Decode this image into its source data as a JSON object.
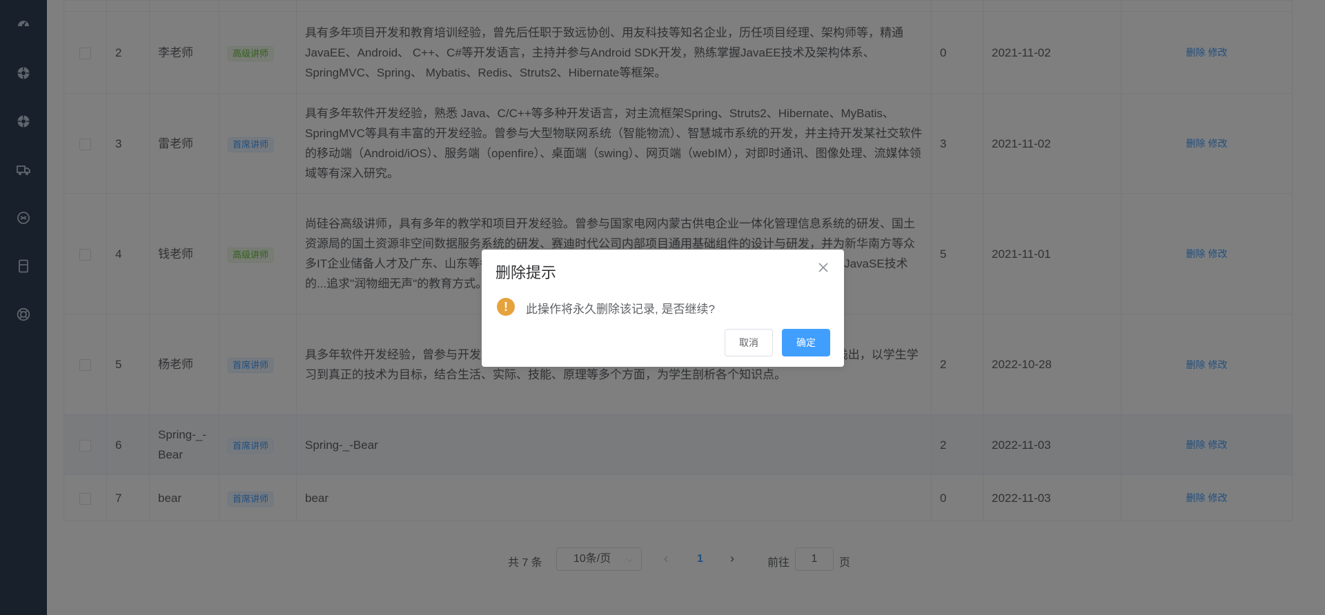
{
  "sidebar": {
    "icons": [
      "dashboard-icon",
      "circle-icon",
      "circle-icon",
      "truck-icon",
      "headset-icon",
      "phone-icon",
      "lifebuoy-icon"
    ]
  },
  "table": {
    "rows": [
      {
        "id": "2",
        "name": "李老师",
        "level": "高级讲师",
        "level_type": "senior",
        "intro": "具有多年项目开发和教育培训经验，曾先后任职于致远协创、用友科技等知名企业，历任项目经理、架构师等，精通JavaEE、Android、 C++、C#等开发语言，主持并参与Android SDK开发，熟练掌握JavaEE技术及架构体系、SpringMVC、Spring、 Mybatis、Redis、Struts2、Hibernate等框架。",
        "sort": "0",
        "date": "2021-11-02",
        "delete": "删除",
        "edit": "修改"
      },
      {
        "id": "3",
        "name": "雷老师",
        "level": "首席讲师",
        "level_type": "chief",
        "intro": "具有多年软件开发经验，熟悉 Java、C/C++等多种开发语言，对主流框架Spring、Struts2、Hibernate、MyBatis、SpringMVC等具有丰富的开发经验。曾参与大型物联网系统（智能物流）、智慧城市系统的开发，并主持开发某社交软件的移动端（Android/iOS）、服务端（openfire）、桌面端（swing）、网页端（webIM），对即时通讯、图像处理、流媒体领域等有深入研究。",
        "sort": "3",
        "date": "2021-11-02",
        "delete": "删除",
        "edit": "修改"
      },
      {
        "id": "4",
        "name": "钱老师",
        "level": "高级讲师",
        "level_type": "senior",
        "intro": "尚硅谷高级讲师，具有多年的教学和项目开发经验。曾参与国家电网内蒙古供电企业一体化管理信息系统的研发、国土资源局的国土资源非空间数据服务系统的研发、赛迪时代公司内部项目通用基础组件的设计与研发，并为新华南方等众多IT企业储备人才及广东、山东等各所高校未做整合出来的项目...MyBatis、JBPM等众多框架，现专注于JavaSE技术的...追求\"润物细无声\"的教育方式。",
        "sort": "5",
        "date": "2021-11-01",
        "delete": "删除",
        "edit": "修改"
      },
      {
        "id": "5",
        "name": "杨老师",
        "level": "首席讲师",
        "level_type": "chief",
        "intro": "具多年软件开发经验，曾参与开发...理有深刻理解，精通jQuery等JavaScript框架...滴，层次明确，深入浅出，以学生学习到真正的技术为目标，结合生活、实际、技能、原理等多个方面，为学生剖析各个知识点。",
        "sort": "2",
        "date": "2022-10-28",
        "delete": "删除",
        "edit": "修改"
      },
      {
        "id": "6",
        "name": "Spring-_-Bear",
        "level": "首席讲师",
        "level_type": "chief",
        "intro": "Spring-_-Bear",
        "sort": "2",
        "date": "2022-11-03",
        "delete": "删除",
        "edit": "修改"
      },
      {
        "id": "7",
        "name": "bear",
        "level": "首席讲师",
        "level_type": "chief",
        "intro": "bear",
        "sort": "0",
        "date": "2022-11-03",
        "delete": "删除",
        "edit": "修改"
      }
    ]
  },
  "pagination": {
    "total": "共 7 条",
    "page_size": "10条/页",
    "current_page": "1",
    "goto_label": "前往",
    "goto_value": "1",
    "page_unit": "页"
  },
  "dialog": {
    "title": "删除提示",
    "message": "此操作将永久删除该记录, 是否继续?",
    "cancel": "取消",
    "confirm": "确定",
    "warning_icon": "!"
  }
}
